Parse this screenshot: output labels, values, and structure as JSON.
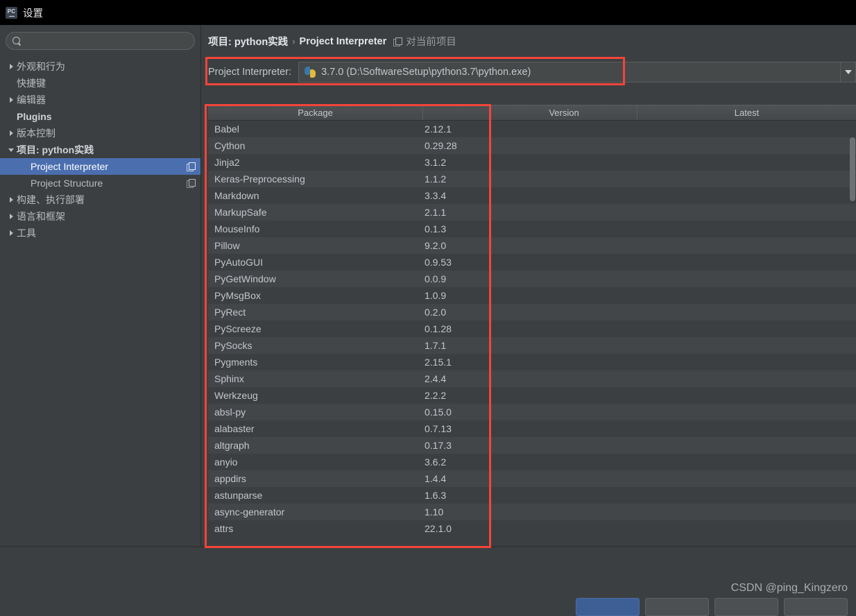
{
  "titlebar": {
    "app_icon": "pycharm-logo-icon",
    "title": "设置"
  },
  "sidebar": {
    "search": {
      "value": "",
      "placeholder": ""
    },
    "items": [
      {
        "label": "外观和行为",
        "arrow": "right",
        "bold": false,
        "indent": 0,
        "selected": false,
        "copy": false
      },
      {
        "label": "快捷键",
        "arrow": "none",
        "bold": false,
        "indent": 0,
        "selected": false,
        "copy": false
      },
      {
        "label": "编辑器",
        "arrow": "right",
        "bold": false,
        "indent": 0,
        "selected": false,
        "copy": false
      },
      {
        "label": "Plugins",
        "arrow": "none",
        "bold": true,
        "indent": 0,
        "selected": false,
        "copy": false
      },
      {
        "label": "版本控制",
        "arrow": "right",
        "bold": false,
        "indent": 0,
        "selected": false,
        "copy": false
      },
      {
        "label": "项目: python实践",
        "arrow": "down",
        "bold": true,
        "indent": 0,
        "selected": false,
        "copy": false
      },
      {
        "label": "Project Interpreter",
        "arrow": "none",
        "bold": false,
        "indent": 1,
        "selected": true,
        "copy": true
      },
      {
        "label": "Project Structure",
        "arrow": "none",
        "bold": false,
        "indent": 1,
        "selected": false,
        "copy": true
      },
      {
        "label": "构建、执行部署",
        "arrow": "right",
        "bold": false,
        "indent": 0,
        "selected": false,
        "copy": false
      },
      {
        "label": "语言和框架",
        "arrow": "right",
        "bold": false,
        "indent": 0,
        "selected": false,
        "copy": false
      },
      {
        "label": "工具",
        "arrow": "right",
        "bold": false,
        "indent": 0,
        "selected": false,
        "copy": false
      }
    ]
  },
  "breadcrumb": {
    "project": "项目: python实践",
    "separator": "›",
    "page": "Project Interpreter",
    "scope_note": "对当前项目"
  },
  "interpreter": {
    "label": "Project Interpreter:",
    "value": "3.7.0 (D:\\SoftwareSetup\\python3.7\\python.exe)",
    "icon": "python-icon"
  },
  "packages_table": {
    "columns": [
      "Package",
      "",
      "Version",
      "Latest"
    ],
    "rows": [
      {
        "name": "Babel",
        "version": "2.12.1",
        "latest": ""
      },
      {
        "name": "Cython",
        "version": "0.29.28",
        "latest": ""
      },
      {
        "name": "Jinja2",
        "version": "3.1.2",
        "latest": ""
      },
      {
        "name": "Keras-Preprocessing",
        "version": "1.1.2",
        "latest": ""
      },
      {
        "name": "Markdown",
        "version": "3.3.4",
        "latest": ""
      },
      {
        "name": "MarkupSafe",
        "version": "2.1.1",
        "latest": ""
      },
      {
        "name": "MouseInfo",
        "version": "0.1.3",
        "latest": ""
      },
      {
        "name": "Pillow",
        "version": "9.2.0",
        "latest": ""
      },
      {
        "name": "PyAutoGUI",
        "version": "0.9.53",
        "latest": ""
      },
      {
        "name": "PyGetWindow",
        "version": "0.0.9",
        "latest": ""
      },
      {
        "name": "PyMsgBox",
        "version": "1.0.9",
        "latest": ""
      },
      {
        "name": "PyRect",
        "version": "0.2.0",
        "latest": ""
      },
      {
        "name": "PyScreeze",
        "version": "0.1.28",
        "latest": ""
      },
      {
        "name": "PySocks",
        "version": "1.7.1",
        "latest": ""
      },
      {
        "name": "Pygments",
        "version": "2.15.1",
        "latest": ""
      },
      {
        "name": "Sphinx",
        "version": "2.4.4",
        "latest": ""
      },
      {
        "name": "Werkzeug",
        "version": "2.2.2",
        "latest": ""
      },
      {
        "name": "absl-py",
        "version": "0.15.0",
        "latest": ""
      },
      {
        "name": "alabaster",
        "version": "0.7.13",
        "latest": ""
      },
      {
        "name": "altgraph",
        "version": "0.17.3",
        "latest": ""
      },
      {
        "name": "anyio",
        "version": "3.6.2",
        "latest": ""
      },
      {
        "name": "appdirs",
        "version": "1.4.4",
        "latest": ""
      },
      {
        "name": "astunparse",
        "version": "1.6.3",
        "latest": ""
      },
      {
        "name": "async-generator",
        "version": "1.10",
        "latest": ""
      },
      {
        "name": "attrs",
        "version": "22.1.0",
        "latest": ""
      }
    ]
  },
  "watermark": "CSDN @ping_Kingzero",
  "colors": {
    "selection_blue": "#4b6eaf",
    "annotation_red": "#f4443a",
    "panel_bg": "#3c3f41",
    "row_alt_bg": "#434649",
    "header_bg": "#4a4d4f"
  }
}
